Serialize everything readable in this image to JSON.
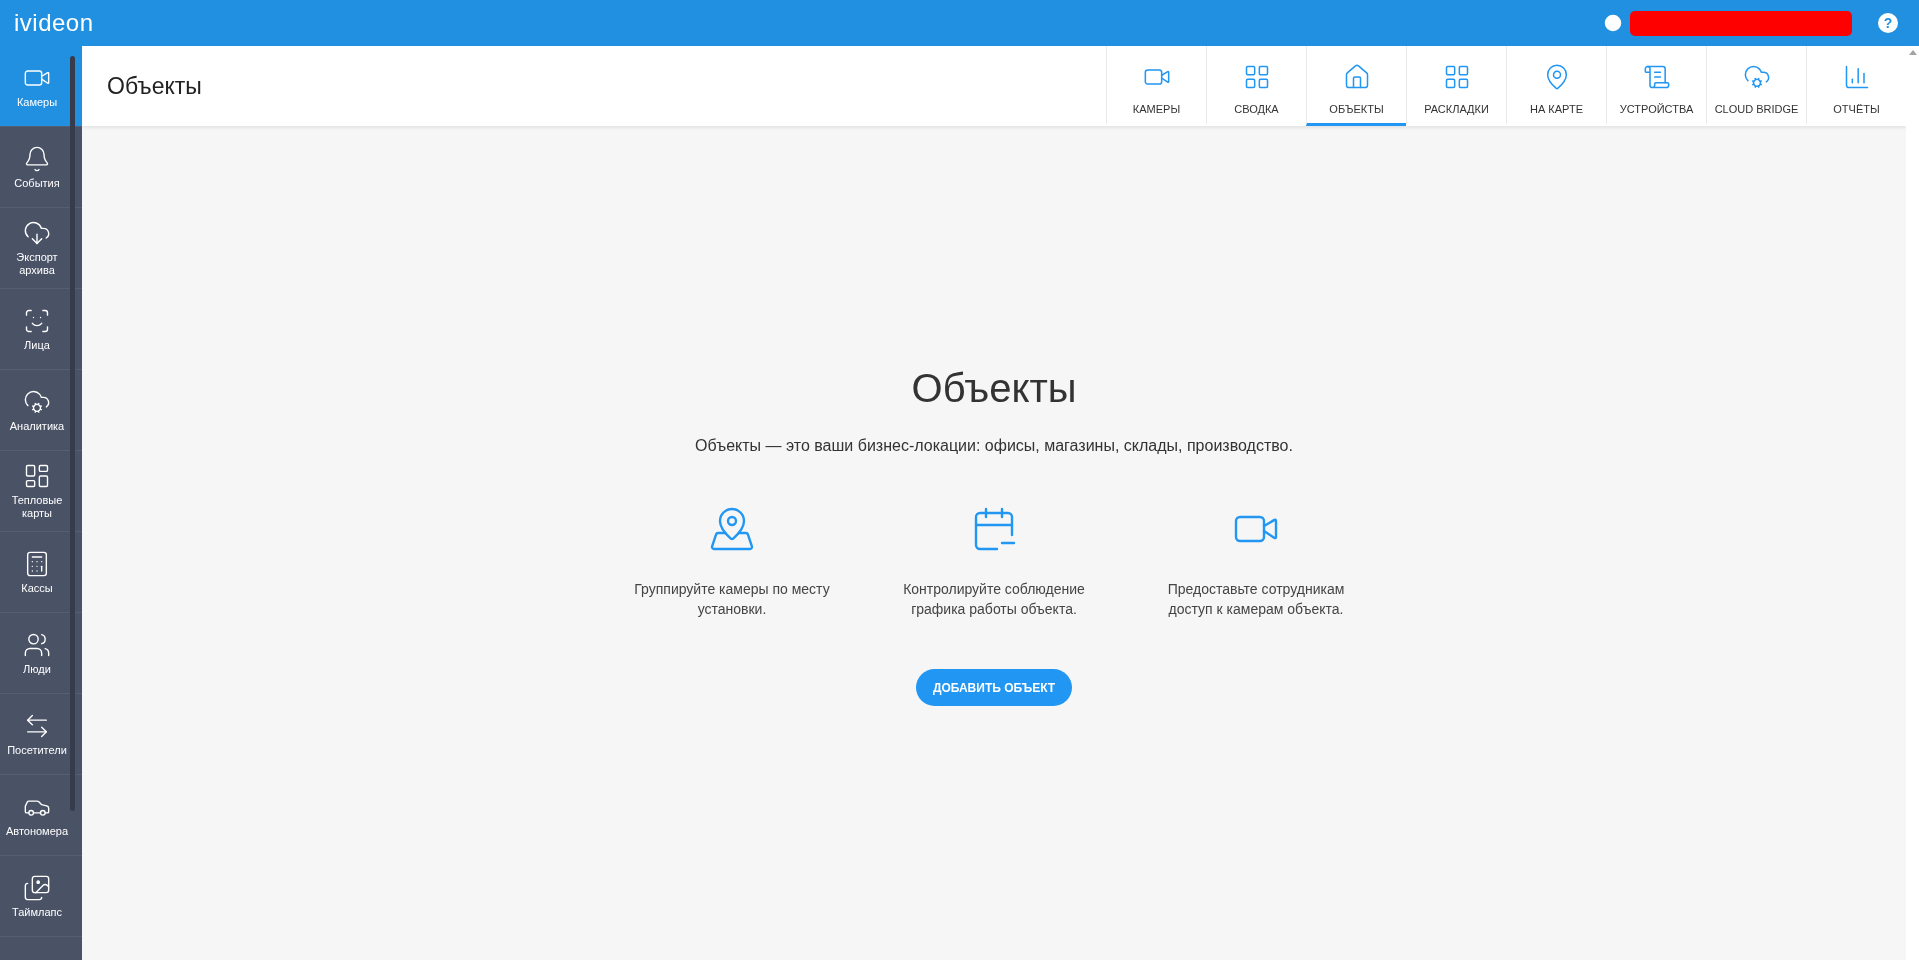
{
  "topbar": {
    "logo": "ivideon",
    "help": "?"
  },
  "sidebar": {
    "items": [
      {
        "label": "Камеры",
        "selected": true
      },
      {
        "label": "События",
        "selected": false
      },
      {
        "label": "Экспорт архива",
        "selected": false
      },
      {
        "label": "Лица",
        "selected": false
      },
      {
        "label": "Аналитика",
        "selected": false
      },
      {
        "label": "Тепловые карты",
        "selected": false
      },
      {
        "label": "Кассы",
        "selected": false
      },
      {
        "label": "Люди",
        "selected": false
      },
      {
        "label": "Посетители",
        "selected": false
      },
      {
        "label": "Автономера",
        "selected": false
      },
      {
        "label": "Таймлапс",
        "selected": false
      }
    ]
  },
  "header": {
    "title": "Объекты",
    "tabs": [
      {
        "label": "КАМЕРЫ",
        "selected": false
      },
      {
        "label": "СВОДКА",
        "selected": false
      },
      {
        "label": "ОБЪЕКТЫ",
        "selected": true
      },
      {
        "label": "РАСКЛАДКИ",
        "selected": false
      },
      {
        "label": "НА КАРТЕ",
        "selected": false
      },
      {
        "label": "УСТРОЙСТВА",
        "selected": false
      },
      {
        "label": "CLOUD BRIDGE",
        "selected": false
      },
      {
        "label": "ОТЧЁТЫ",
        "selected": false
      }
    ]
  },
  "main": {
    "heading": "Объекты",
    "description": "Объекты — это ваши бизнес-локации: офисы, магазины, склады, производство.",
    "features": [
      {
        "text": "Группируйте камеры по месту установки."
      },
      {
        "text": "Контролируйте соблюдение графика работы объекта."
      },
      {
        "text": "Предоставьте сотрудникам доступ к камерам объекта."
      }
    ],
    "button": "ДОБАВИТЬ ОБЪЕКТ"
  }
}
